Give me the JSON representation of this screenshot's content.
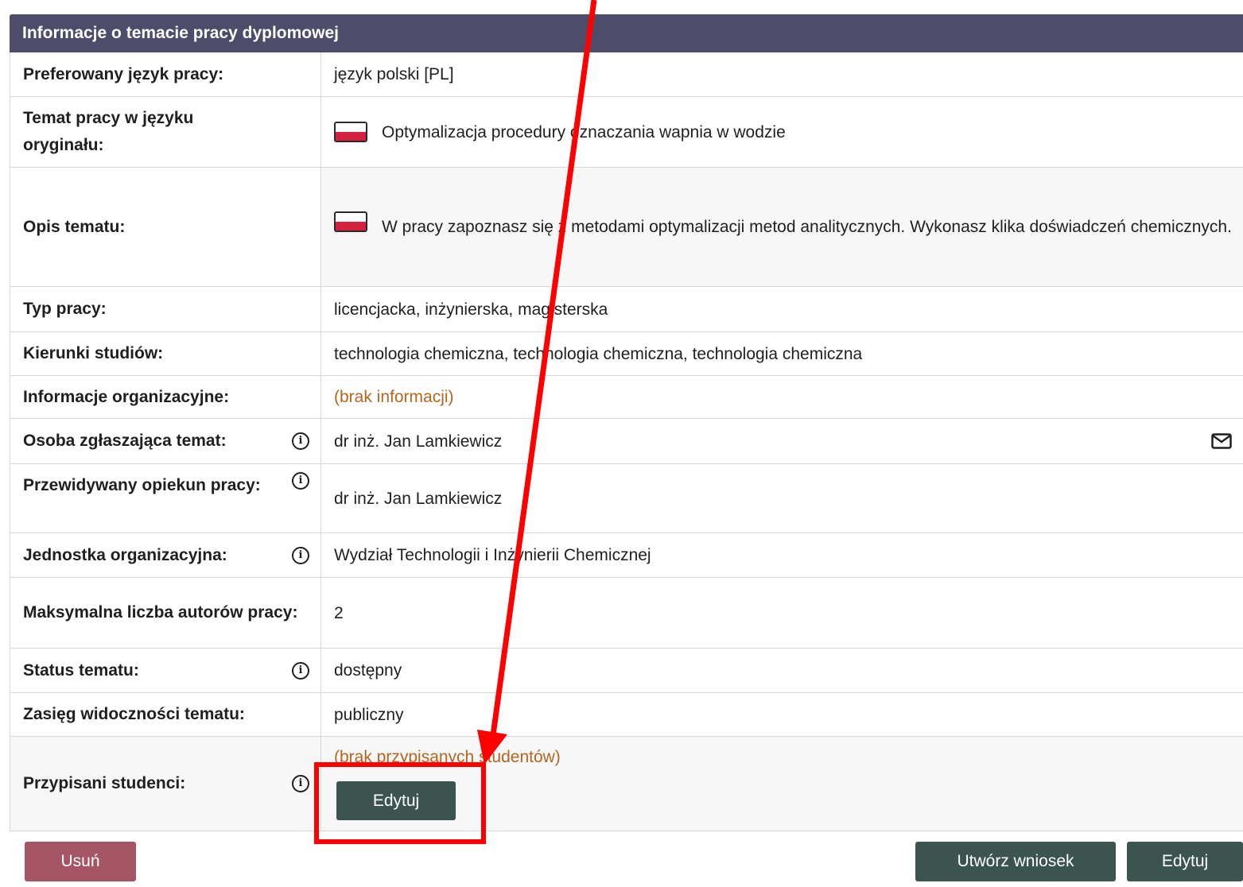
{
  "panel": {
    "title": "Informacje o temacie pracy dyplomowej"
  },
  "rows": {
    "language": {
      "label": "Preferowany język pracy:",
      "value": "język polski [PL]"
    },
    "topic": {
      "label": "Temat pracy w języku oryginału:",
      "value": "Optymalizacja procedury oznaczania wapnia w wodzie",
      "flag": "pl-flag-icon"
    },
    "description": {
      "label": "Opis tematu:",
      "value": "W pracy zapoznasz się z metodami optymalizacji metod analitycznych. Wykonasz klika doświadczeń chemicznych.",
      "flag": "pl-flag-icon"
    },
    "type": {
      "label": "Typ pracy:",
      "value": "licencjacka, inżynierska, magisterska"
    },
    "fields": {
      "label": "Kierunki studiów:",
      "value": "technologia chemiczna, technologia chemiczna, technologia chemiczna"
    },
    "org_info": {
      "label": "Informacje organizacyjne:",
      "value": "(brak informacji)"
    },
    "proposer": {
      "label": "Osoba zgłaszająca temat:",
      "value": "dr inż. Jan Lamkiewicz",
      "icon": "mail-icon"
    },
    "supervisor": {
      "label": "Przewidywany opiekun pracy:",
      "value": "dr inż. Jan Lamkiewicz"
    },
    "unit": {
      "label": "Jednostka organizacyjna:",
      "value": "Wydział Technologii i Inżynierii Chemicznej"
    },
    "max_authors": {
      "label": "Maksymalna liczba autorów pracy:",
      "value": "2"
    },
    "status": {
      "label": "Status tematu:",
      "value": "dostępny"
    },
    "visibility": {
      "label": "Zasięg widoczności tematu:",
      "value": "publiczny"
    },
    "students": {
      "label": "Przypisani studenci:",
      "value": "(brak przypisanych studentów)",
      "edit_label": "Edytuj"
    }
  },
  "actions": {
    "delete_label": "Usuń",
    "create_request_label": "Utwórz wniosek",
    "edit_label": "Edytuj"
  },
  "info_icon_glyph": "i",
  "colors": {
    "header_bg": "#4e4c6b",
    "button_bg": "#3b5450",
    "danger_bg": "#a55566",
    "muted_text": "#b5651d",
    "annotation": "#ff0000"
  }
}
